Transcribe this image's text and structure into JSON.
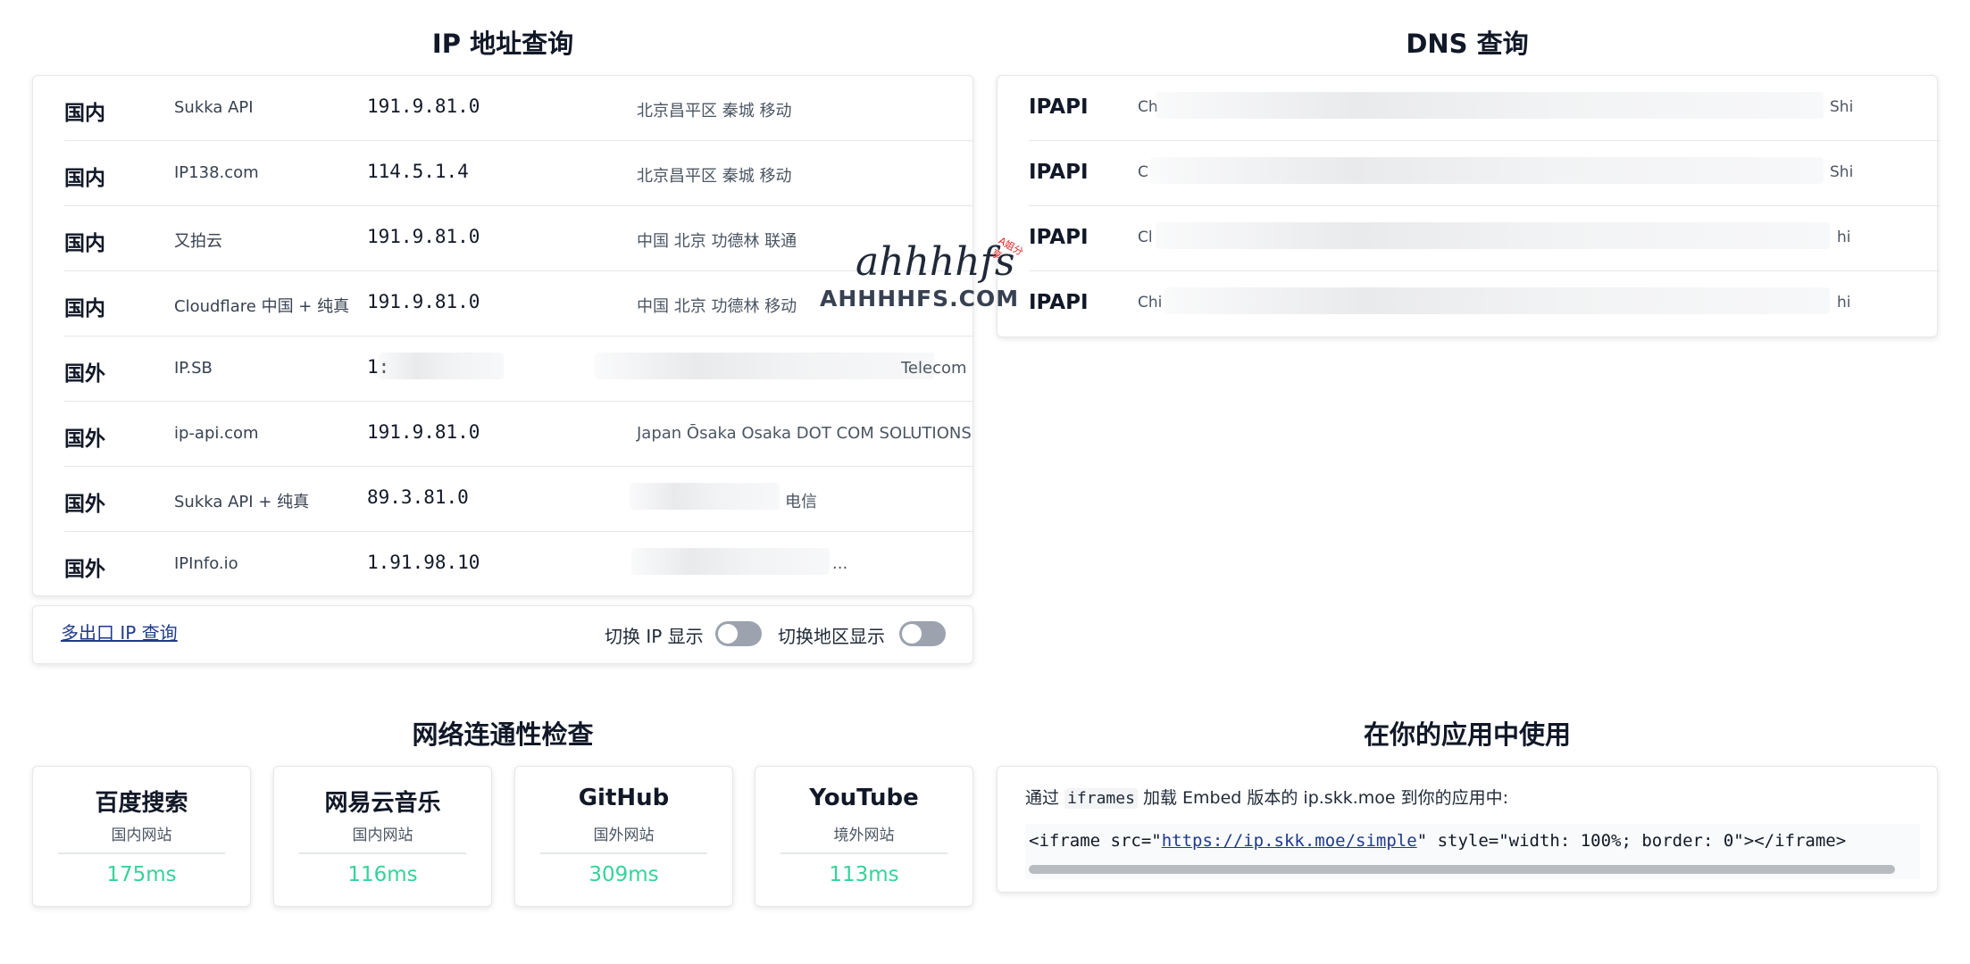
{
  "ip_section": {
    "title": "IP 地址查询",
    "rows": [
      {
        "region": "国内",
        "source": "Sukka API",
        "ip": "191.9.81.0",
        "location": "北京昌平区 秦城 移动"
      },
      {
        "region": "国内",
        "source": "IP138.com",
        "ip": "114.5.1.4",
        "location": "北京昌平区 秦城 移动"
      },
      {
        "region": "国内",
        "source": "又拍云",
        "ip": "191.9.81.0",
        "location": "中国 北京 功德林 联通"
      },
      {
        "region": "国内",
        "source": "Cloudflare 中国 + 纯真",
        "ip": "191.9.81.0",
        "location": "中国 北京 功德林 移动"
      },
      {
        "region": "国外",
        "source": "IP.SB",
        "ip": "1:",
        "location": "Telecom"
      },
      {
        "region": "国外",
        "source": "ip-api.com",
        "ip": "191.9.81.0",
        "location": "Japan Ōsaka Osaka DOT COM SOLUTIONS"
      },
      {
        "region": "国外",
        "source": "Sukka API + 纯真",
        "ip": "89.3.81.0",
        "location": "电信"
      },
      {
        "region": "国外",
        "source": "IPInfo.io",
        "ip": "1.91.98.10",
        "location": "..."
      }
    ],
    "multi_exit_link": "多出口 IP 查询",
    "toggle_ip_label": "切换 IP 显示",
    "toggle_region_label": "切换地区显示"
  },
  "dns_section": {
    "title": "DNS 查询",
    "rows": [
      {
        "name": "IPAPI",
        "pre": "Ch",
        "post": "Shi"
      },
      {
        "name": "IPAPI",
        "pre": "C",
        "post": "Shi"
      },
      {
        "name": "IPAPI",
        "pre": "Cl",
        "post": "hi"
      },
      {
        "name": "IPAPI",
        "pre": "Chi",
        "post": "hi"
      }
    ]
  },
  "connectivity_section": {
    "title": "网络连通性检查",
    "sites": [
      {
        "name": "百度搜索",
        "type": "国内网站",
        "latency": "175ms"
      },
      {
        "name": "网易云音乐",
        "type": "国内网站",
        "latency": "116ms"
      },
      {
        "name": "GitHub",
        "type": "国外网站",
        "latency": "309ms"
      },
      {
        "name": "YouTube",
        "type": "境外网站",
        "latency": "113ms"
      }
    ]
  },
  "embed_section": {
    "title": "在你的应用中使用",
    "desc_prefix": "通过",
    "desc_code": "iframes",
    "desc_suffix": "加载 Embed 版本的 ip.skk.moe 到你的应用中:",
    "code_before": "<iframe src=\"",
    "code_url": "https://ip.skk.moe/simple",
    "code_after": "\" style=\"width: 100%; border: 0\"></iframe>"
  },
  "watermark": {
    "logo": "ahhhhfs",
    "site": "AHHHHFS.COM",
    "tag": "A姐分享"
  },
  "colors": {
    "latency": "#34d399",
    "link": "#1e3a8a",
    "toggle_off": "#9ca3af"
  }
}
